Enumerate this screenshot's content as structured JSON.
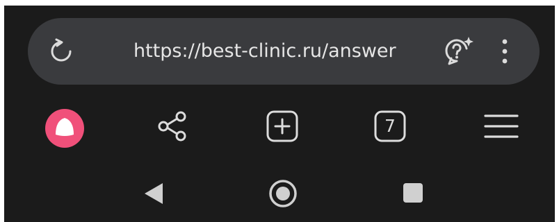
{
  "address_bar": {
    "url": "https://best-clinic.ru/answer",
    "reload_icon": "reload-icon",
    "assistant_icon": "chat-question-sparkle-icon",
    "menu_icon": "more-vertical-icon"
  },
  "toolbar": {
    "alice_icon": "alice-assistant-icon",
    "share_icon": "share-icon",
    "new_tab_icon": "plus-square-icon",
    "tab_count": "7",
    "menu_icon": "hamburger-menu-icon"
  },
  "system_nav": {
    "back_icon": "triangle-back-icon",
    "home_icon": "circle-home-icon",
    "recents_icon": "square-recents-icon"
  },
  "colors": {
    "background": "#1b1b1b",
    "address_bar": "#3a3b3e",
    "alice_accent": "#f0507a",
    "icon": "#dcdcdc"
  }
}
